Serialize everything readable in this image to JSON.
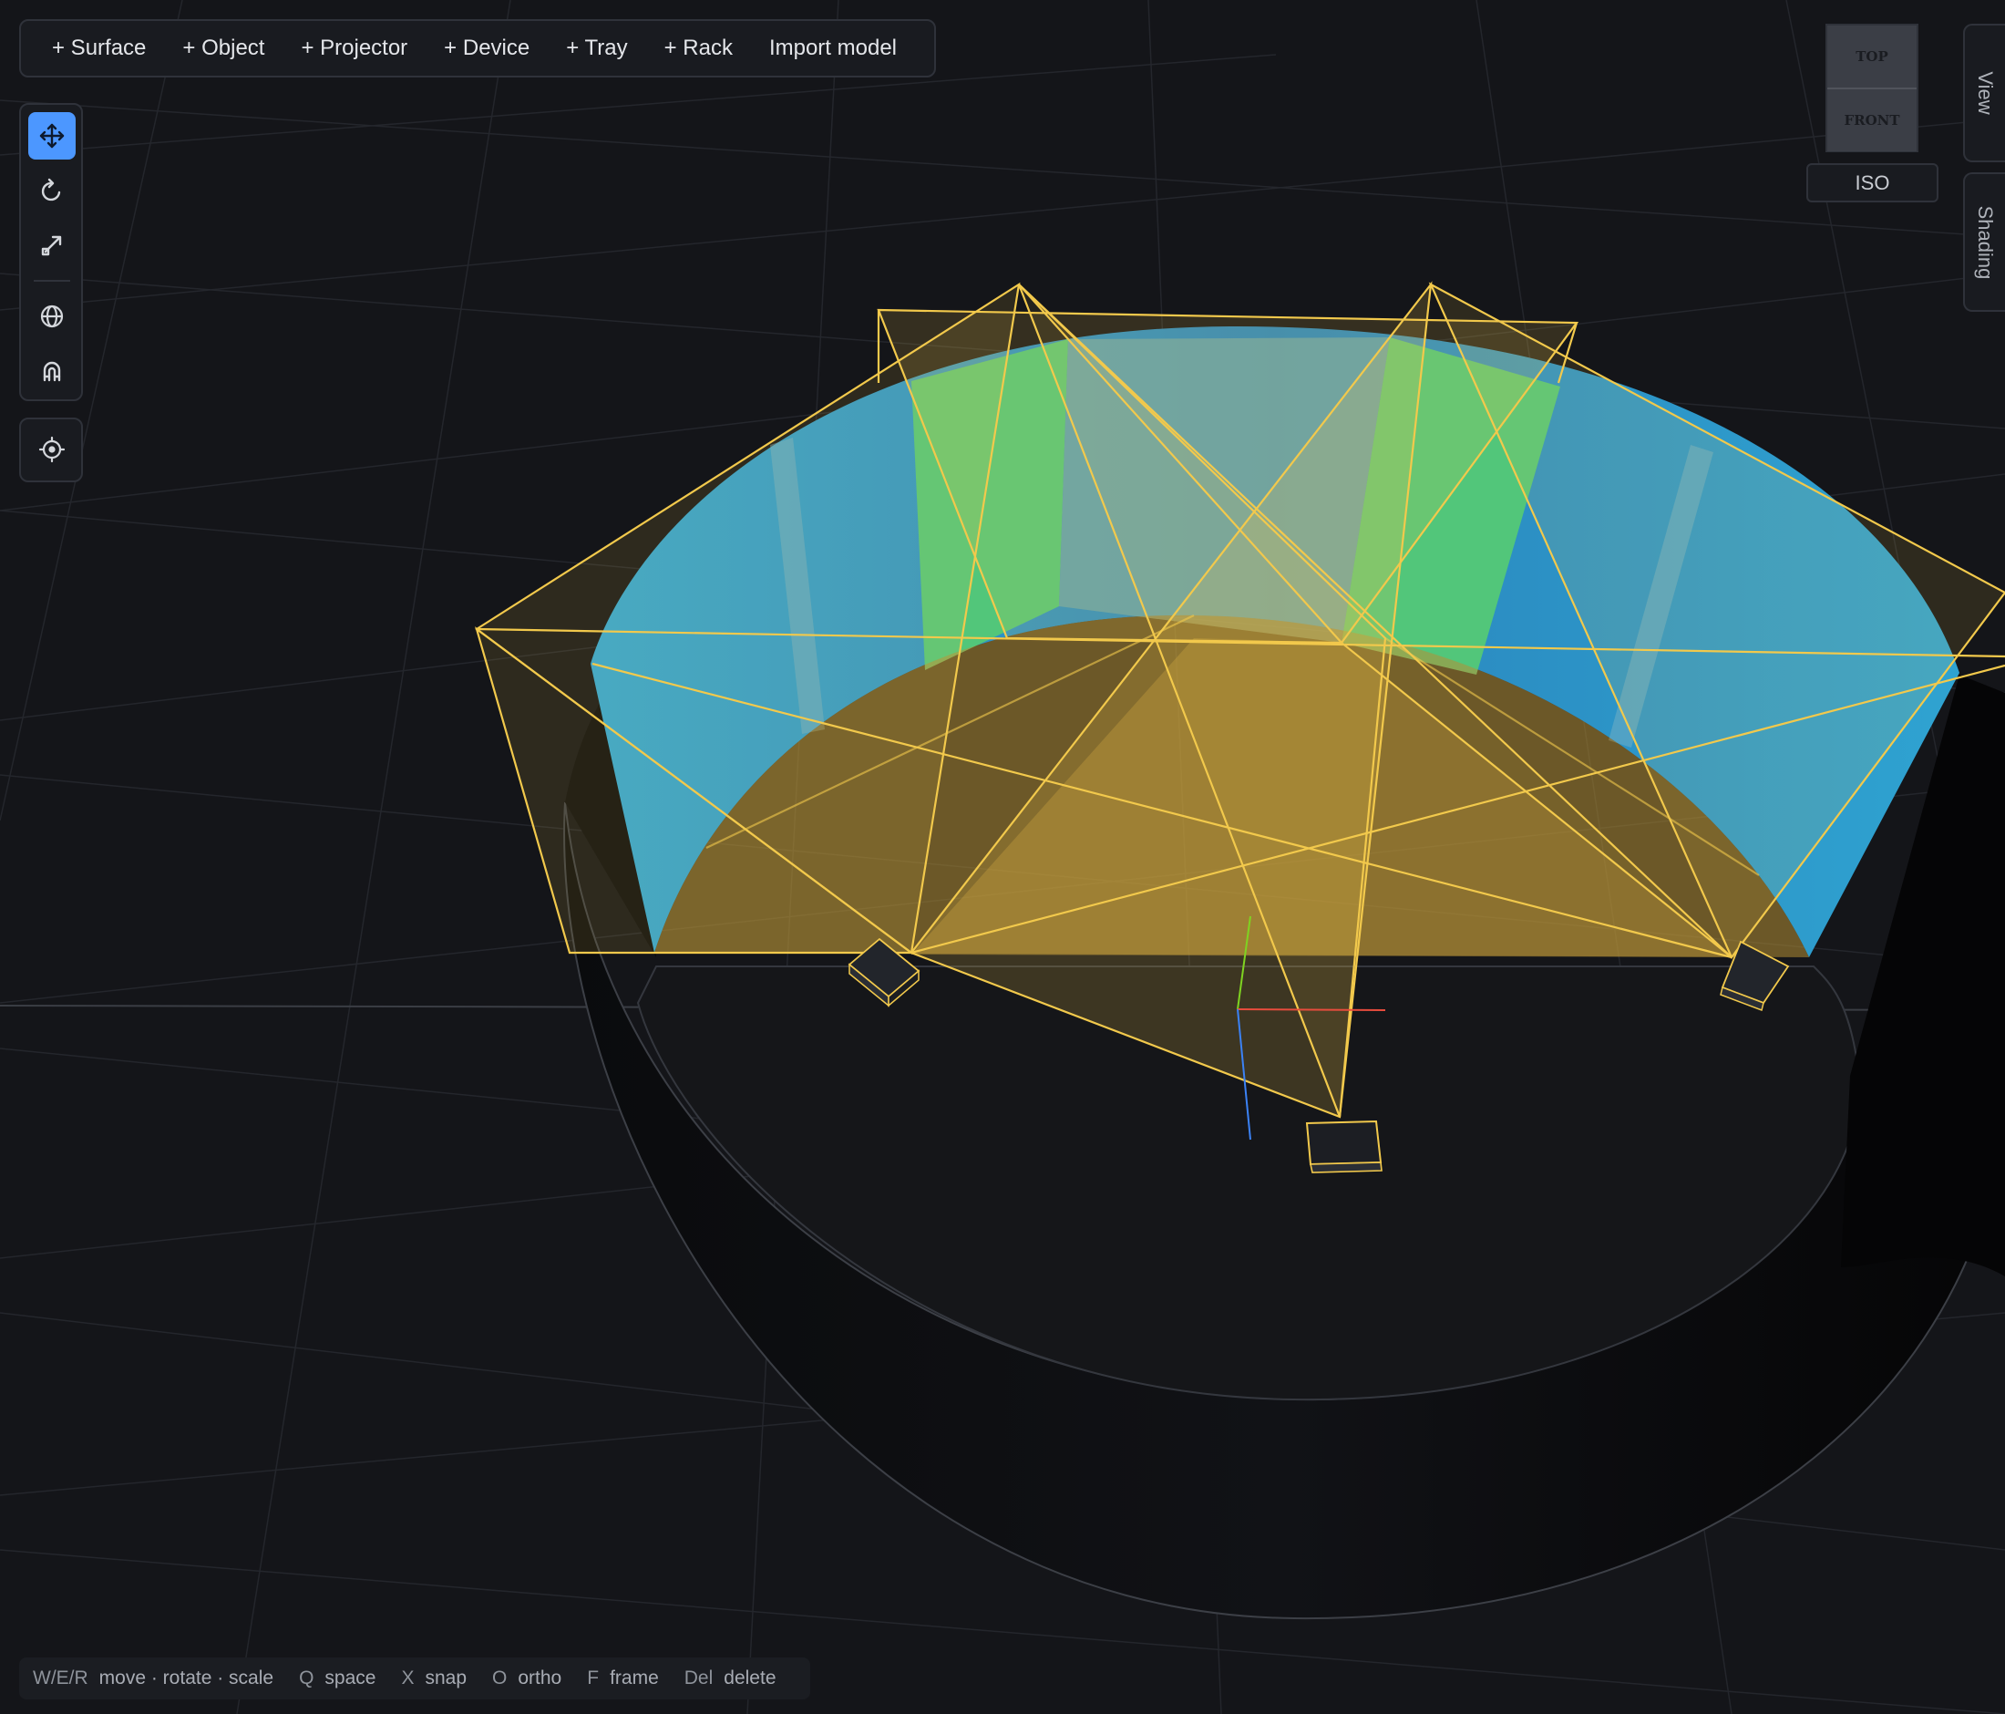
{
  "toolbar": {
    "add_surface": "+ Surface",
    "add_object": "+ Object",
    "add_projector": "+ Projector",
    "add_device": "+ Device",
    "add_tray": "+ Tray",
    "add_rack": "+ Rack",
    "import_model": "Import model"
  },
  "tools": {
    "active": "move",
    "items": [
      "move-icon",
      "rotate-icon",
      "scale-icon",
      "globe-icon",
      "magnet-icon",
      "crosshair-icon"
    ]
  },
  "view_cube": {
    "top": "TOP",
    "front": "FRONT",
    "iso": "ISO"
  },
  "side_tabs": {
    "view": "View",
    "shading": "Shading"
  },
  "hotkeys": [
    {
      "key": "W/E/R",
      "action": "move · rotate · scale"
    },
    {
      "key": "Q",
      "action": "space"
    },
    {
      "key": "X",
      "action": "snap"
    },
    {
      "key": "O",
      "action": "ortho"
    },
    {
      "key": "F",
      "action": "frame"
    },
    {
      "key": "Del",
      "action": "delete"
    }
  ],
  "colors": {
    "background": "#141519",
    "surface_blue": "#2b8fc4",
    "surface_green": "#4fc67a",
    "frustum_yellow": "#f2c94c",
    "accent": "#4c97ff"
  }
}
